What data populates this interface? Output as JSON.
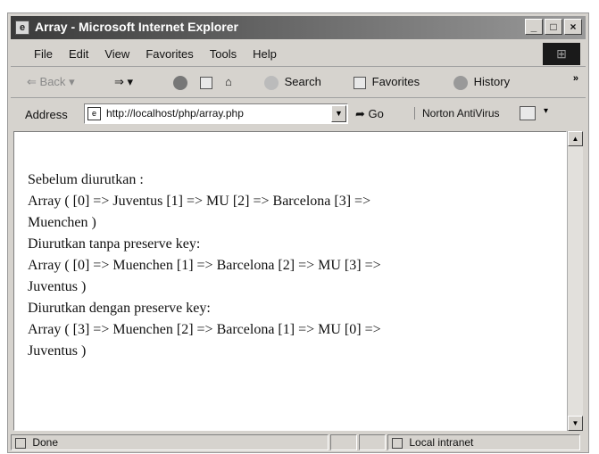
{
  "window": {
    "title": "Array - Microsoft Internet Explorer"
  },
  "window_buttons": {
    "minimize": "_",
    "maximize": "□",
    "close": "×"
  },
  "menu": [
    "File",
    "Edit",
    "View",
    "Favorites",
    "Tools",
    "Help"
  ],
  "toolbar": {
    "back": "Back",
    "search": "Search",
    "favorites": "Favorites",
    "history": "History",
    "more": "»"
  },
  "address": {
    "label": "Address",
    "url": "http://localhost/php/array.php",
    "go": "Go",
    "norton": "Norton AntiVirus"
  },
  "content": {
    "lines": [
      "Sebelum diurutkan :",
      "Array ( [0] => Juventus [1] => MU [2] => Barcelona [3] =>",
      "Muenchen )",
      "Diurutkan tanpa preserve key:",
      "Array ( [0] => Muenchen [1] => Barcelona [2] => MU [3] =>",
      "Juventus )",
      "Diurutkan dengan preserve key:",
      "Array ( [3] => Muenchen [2] => Barcelona [1] => MU [0] =>",
      "Juventus )"
    ]
  },
  "status": {
    "left": "Done",
    "zone": "Local intranet"
  }
}
